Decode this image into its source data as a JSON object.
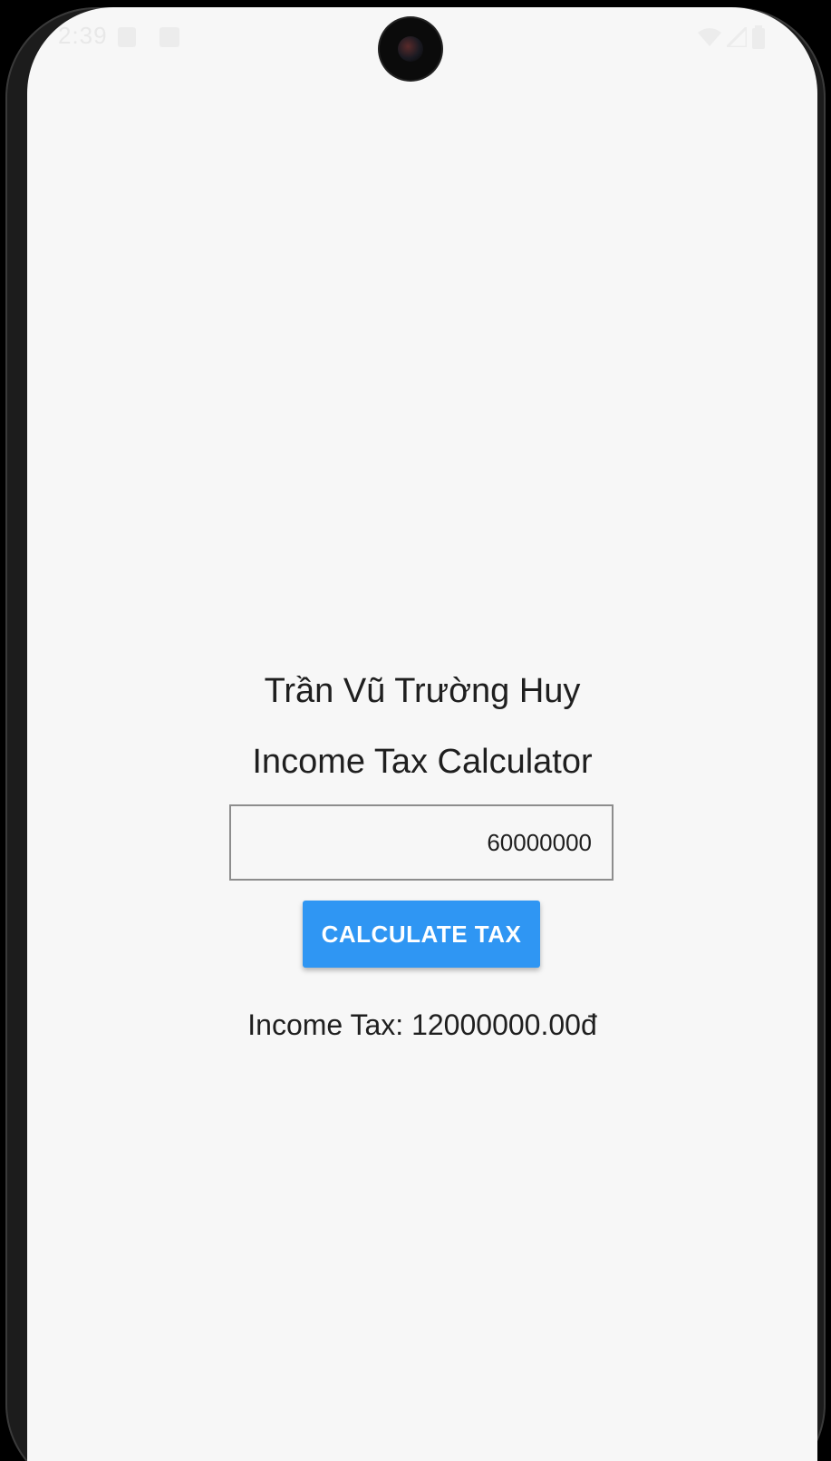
{
  "status_bar": {
    "time": "2:39",
    "left_icons": [
      "notification-icon",
      "app-icon"
    ],
    "right_icons": [
      "wifi-icon",
      "signal-icon",
      "battery-icon"
    ]
  },
  "app": {
    "author_name": "Trần Vũ Trường Huy",
    "title": "Income Tax Calculator",
    "income_input_value": "60000000",
    "calculate_button_label": "CALCULATE TAX",
    "result_text": "Income Tax: 12000000.00đ"
  },
  "colors": {
    "background": "#f7f7f7",
    "button": "#2f96f3",
    "button_text": "#ffffff",
    "text": "#1f1f1f"
  }
}
